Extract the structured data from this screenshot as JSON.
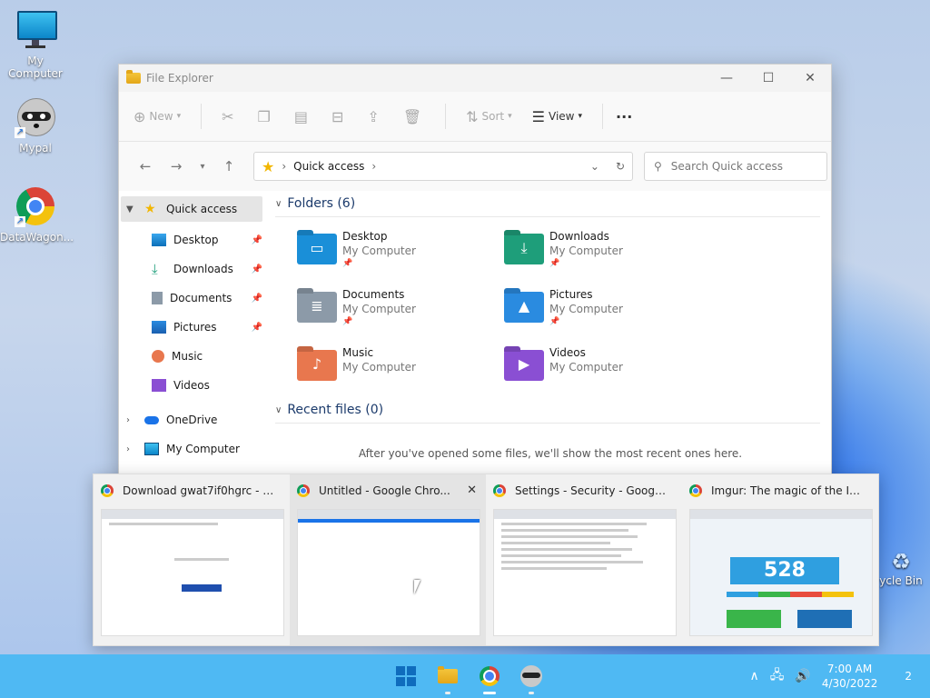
{
  "desktop": {
    "icons": [
      {
        "label": "My Computer",
        "icon": "monitor-icon"
      },
      {
        "label": "Mypal",
        "icon": "raccoon-icon"
      },
      {
        "label": "DataWagon...",
        "icon": "chrome-icon"
      }
    ],
    "recycle_label": "ycle Bin"
  },
  "explorer": {
    "title": "File Explorer",
    "toolbar": {
      "new": "New",
      "sort": "Sort",
      "view": "View",
      "more": "···"
    },
    "address": {
      "location": "Quick access"
    },
    "search": {
      "placeholder": "Search Quick access"
    },
    "sidebar": {
      "quick_access": "Quick access",
      "items": [
        {
          "label": "Desktop"
        },
        {
          "label": "Downloads"
        },
        {
          "label": "Documents"
        },
        {
          "label": "Pictures"
        },
        {
          "label": "Music"
        },
        {
          "label": "Videos"
        }
      ],
      "onedrive": "OneDrive",
      "my_computer": "My Computer"
    },
    "folders_header": "Folders (6)",
    "folders": [
      {
        "name": "Desktop",
        "location": "My Computer",
        "color": "#1a8fd8"
      },
      {
        "name": "Downloads",
        "location": "My Computer",
        "color": "#1e9e7a"
      },
      {
        "name": "Documents",
        "location": "My Computer",
        "color": "#8c9aa8"
      },
      {
        "name": "Pictures",
        "location": "My Computer",
        "color": "#2a8be0"
      },
      {
        "name": "Music",
        "location": "My Computer",
        "color": "#e8774e"
      },
      {
        "name": "Videos",
        "location": "My Computer",
        "color": "#8a4fd3"
      }
    ],
    "recent_header": "Recent files (0)",
    "recent_empty": "After you've opened some files, we'll show the most recent ones here."
  },
  "previews": [
    {
      "title": "Download gwat7if0hgrc - Goo..."
    },
    {
      "title": "Untitled - Google Chro..."
    },
    {
      "title": "Settings - Security - Google Ch..."
    },
    {
      "title": "Imgur: The magic of the Intern..."
    }
  ],
  "preview_content": {
    "score": "528"
  },
  "taskbar": {
    "time": "7:00 AM",
    "date": "4/30/2022",
    "notifications": "2"
  }
}
